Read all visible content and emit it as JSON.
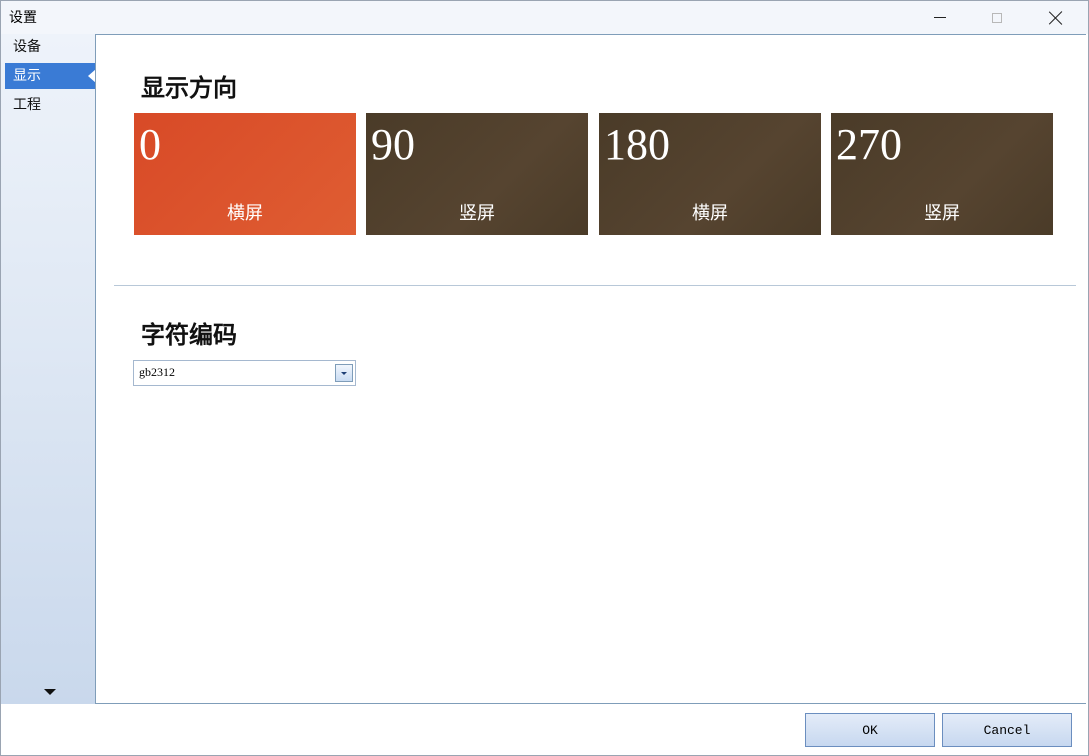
{
  "window": {
    "title": "设置"
  },
  "sidebar": {
    "items": [
      {
        "label": "设备",
        "active": false
      },
      {
        "label": "显示",
        "active": true
      },
      {
        "label": "工程",
        "active": false
      }
    ]
  },
  "main": {
    "orientation": {
      "title": "显示方向",
      "selected_color": "#d84a27",
      "normal_color": "#4e3f2b",
      "tiles": [
        {
          "value": "0",
          "label": "横屏",
          "selected": true
        },
        {
          "value": "90",
          "label": "竖屏",
          "selected": false
        },
        {
          "value": "180",
          "label": "横屏",
          "selected": false
        },
        {
          "value": "270",
          "label": "竖屏",
          "selected": false
        }
      ]
    },
    "encoding": {
      "title": "字符编码",
      "value": "gb2312"
    }
  },
  "footer": {
    "ok_label": "OK",
    "cancel_label": "Cancel"
  }
}
